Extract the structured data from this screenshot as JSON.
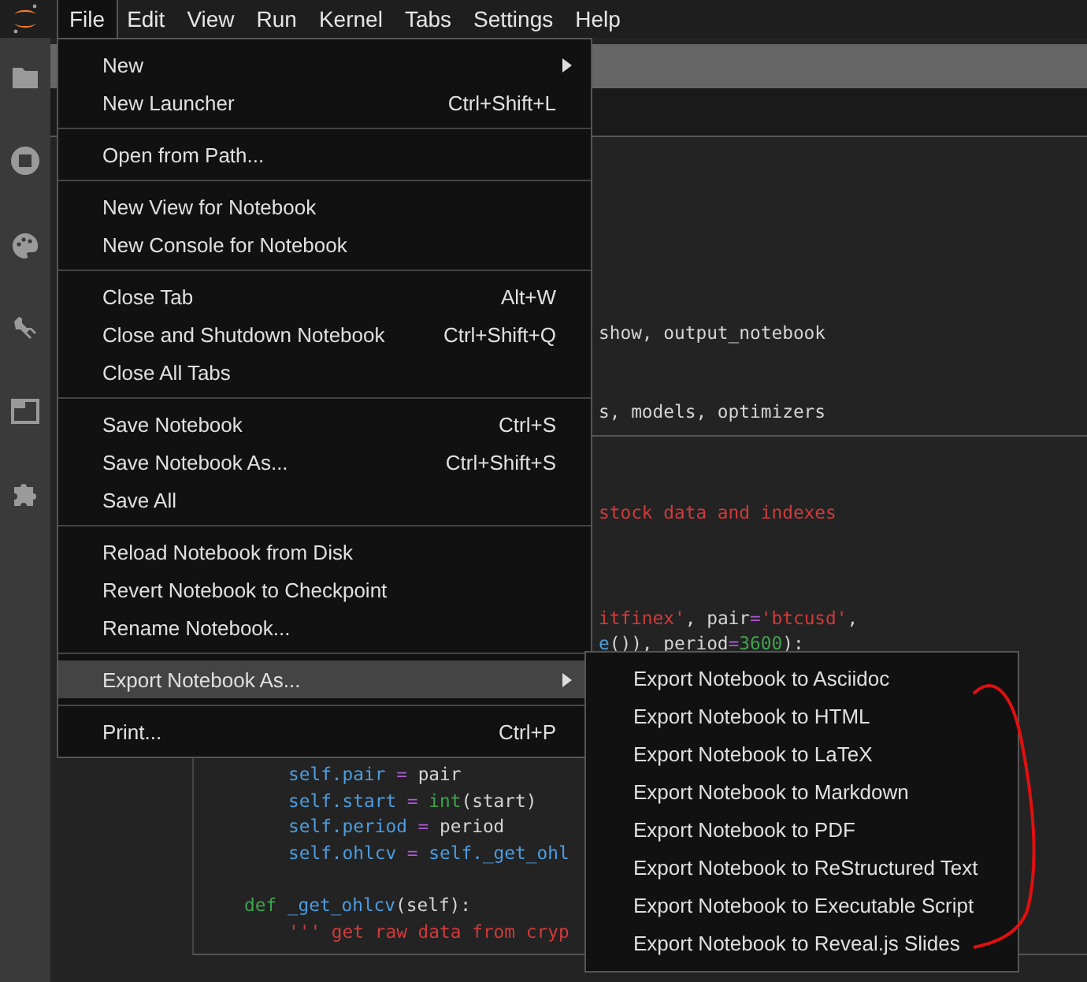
{
  "menubar": [
    {
      "label": "File",
      "selected": true
    },
    {
      "label": "Edit",
      "selected": false
    },
    {
      "label": "View",
      "selected": false
    },
    {
      "label": "Run",
      "selected": false
    },
    {
      "label": "Kernel",
      "selected": false
    },
    {
      "label": "Tabs",
      "selected": false
    },
    {
      "label": "Settings",
      "selected": false
    },
    {
      "label": "Help",
      "selected": false
    }
  ],
  "file_menu": [
    [
      {
        "label": "New",
        "submenu": true,
        "selected": false
      },
      {
        "label": "New Launcher",
        "shortcut": "Ctrl+Shift+L",
        "submenu": false,
        "selected": false
      }
    ],
    [
      {
        "label": "Open from Path...",
        "submenu": false,
        "selected": false
      }
    ],
    [
      {
        "label": "New View for Notebook",
        "submenu": false,
        "selected": false
      },
      {
        "label": "New Console for Notebook",
        "submenu": false,
        "selected": false
      }
    ],
    [
      {
        "label": "Close Tab",
        "shortcut": "Alt+W",
        "submenu": false,
        "selected": false
      },
      {
        "label": "Close and Shutdown Notebook",
        "shortcut": "Ctrl+Shift+Q",
        "submenu": false,
        "selected": false
      },
      {
        "label": "Close All Tabs",
        "submenu": false,
        "selected": false
      }
    ],
    [
      {
        "label": "Save Notebook",
        "shortcut": "Ctrl+S",
        "submenu": false,
        "selected": false
      },
      {
        "label": "Save Notebook As...",
        "shortcut": "Ctrl+Shift+S",
        "submenu": false,
        "selected": false
      },
      {
        "label": "Save All",
        "submenu": false,
        "selected": false
      }
    ],
    [
      {
        "label": "Reload Notebook from Disk",
        "submenu": false,
        "selected": false
      },
      {
        "label": "Revert Notebook to Checkpoint",
        "submenu": false,
        "selected": false
      },
      {
        "label": "Rename Notebook...",
        "submenu": false,
        "selected": false
      }
    ],
    [
      {
        "label": "Export Notebook As...",
        "submenu": true,
        "selected": true
      }
    ],
    [
      {
        "label": "Print...",
        "shortcut": "Ctrl+P",
        "submenu": false,
        "selected": false
      }
    ]
  ],
  "export_submenu": [
    "Export Notebook to Asciidoc",
    "Export Notebook to HTML",
    "Export Notebook to LaTeX",
    "Export Notebook to Markdown",
    "Export Notebook to PDF",
    "Export Notebook to ReStructured Text",
    "Export Notebook to Executable Script",
    "Export Notebook to Reveal.js Slides"
  ],
  "cells": [
    {
      "lines": [
        {
          "kind": "blank"
        },
        {
          "kind": "blank"
        },
        {
          "kind": "blank"
        },
        {
          "kind": "blank"
        },
        {
          "kind": "blank"
        },
        {
          "kind": "blank"
        },
        {
          "kind": "blank"
        },
        {
          "kind": "partial",
          "tokens": [
            {
              "kind": "plain",
              "t": "show, output_notebook"
            }
          ]
        },
        {
          "kind": "blank"
        },
        {
          "kind": "blank"
        },
        {
          "kind": "partial",
          "tokens": [
            {
              "kind": "plain",
              "t": "s, models, optimizers"
            }
          ]
        }
      ]
    },
    {
      "lines": [
        {
          "kind": "blank"
        },
        {
          "kind": "partial",
          "tokens": [
            {
              "kind": "str",
              "t": "stock data and indexes"
            }
          ]
        },
        {
          "kind": "blank"
        },
        {
          "kind": "blank"
        },
        {
          "kind": "blank"
        },
        {
          "kind": "partial",
          "tokens": [
            {
              "kind": "str",
              "t": "itfinex'"
            },
            {
              "kind": "plain",
              "t": ", pair"
            },
            {
              "kind": "op",
              "t": "="
            },
            {
              "kind": "str",
              "t": "'btcusd'"
            },
            {
              "kind": "plain",
              "t": ","
            }
          ]
        },
        {
          "kind": "partial",
          "tokens": [
            {
              "kind": "self",
              "t": "e"
            },
            {
              "kind": "plain",
              "t": "()), period"
            },
            {
              "kind": "op",
              "t": "="
            },
            {
              "kind": "num",
              "t": "3600"
            },
            {
              "kind": "plain",
              "t": "):"
            }
          ]
        },
        {
          "kind": "blank"
        },
        {
          "kind": "blank"
        },
        {
          "kind": "blank"
        },
        {
          "kind": "blank"
        },
        {
          "kind": "body",
          "tokens": [
            {
              "kind": "self",
              "t": "self.pair"
            },
            {
              "kind": "op",
              "t": " = "
            },
            {
              "kind": "plain",
              "t": "pair"
            }
          ]
        },
        {
          "kind": "body",
          "tokens": [
            {
              "kind": "self",
              "t": "self.start"
            },
            {
              "kind": "op",
              "t": " = "
            },
            {
              "kind": "num",
              "t": "int"
            },
            {
              "kind": "plain",
              "t": "(start)"
            }
          ]
        },
        {
          "kind": "body",
          "tokens": [
            {
              "kind": "self",
              "t": "self.period"
            },
            {
              "kind": "op",
              "t": " = "
            },
            {
              "kind": "plain",
              "t": "period"
            }
          ]
        },
        {
          "kind": "body",
          "tokens": [
            {
              "kind": "self",
              "t": "self.ohlcv"
            },
            {
              "kind": "op",
              "t": " = "
            },
            {
              "kind": "self",
              "t": "self._get_ohl"
            }
          ]
        },
        {
          "kind": "blank"
        },
        {
          "kind": "method",
          "tokens": [
            {
              "kind": "num",
              "t": "def "
            },
            {
              "kind": "self",
              "t": "_get_ohlcv"
            },
            {
              "kind": "plain",
              "t": "(self):"
            }
          ]
        },
        {
          "kind": "body",
          "tokens": [
            {
              "kind": "str",
              "t": "''' get raw data from cryp"
            }
          ]
        }
      ]
    }
  ]
}
